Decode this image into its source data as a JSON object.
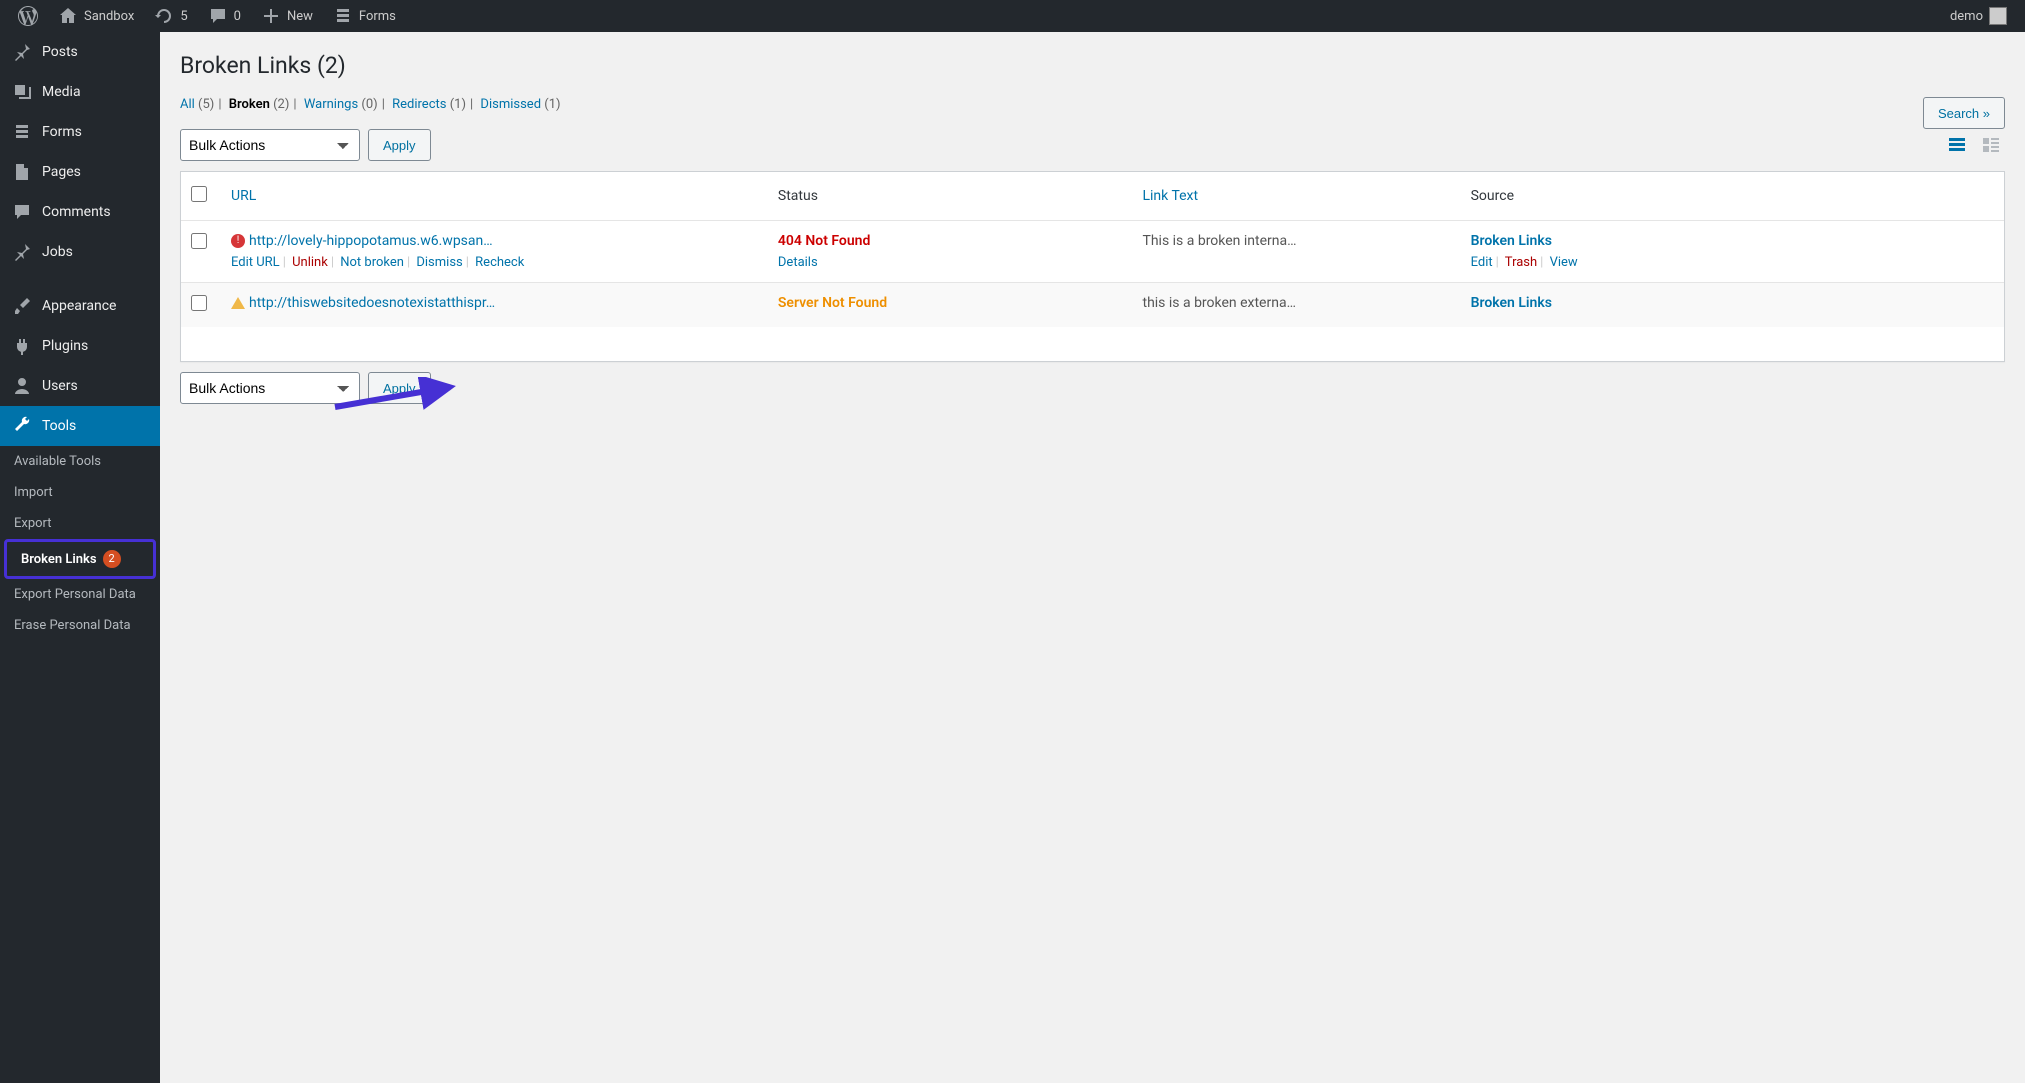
{
  "adminbar": {
    "site_name": "Sandbox",
    "updates": "5",
    "comments": "0",
    "new_label": "New",
    "forms_label": "Forms",
    "user_label": "demo"
  },
  "sidebar": {
    "items": [
      {
        "label": "Posts"
      },
      {
        "label": "Media"
      },
      {
        "label": "Forms"
      },
      {
        "label": "Pages"
      },
      {
        "label": "Comments"
      },
      {
        "label": "Jobs"
      },
      {
        "label": "Appearance"
      },
      {
        "label": "Plugins"
      },
      {
        "label": "Users"
      },
      {
        "label": "Tools"
      }
    ],
    "submenu": [
      {
        "label": "Available Tools"
      },
      {
        "label": "Import"
      },
      {
        "label": "Export"
      },
      {
        "label": "Broken Links",
        "badge": "2"
      },
      {
        "label": "Export Personal Data"
      },
      {
        "label": "Erase Personal Data"
      }
    ]
  },
  "page": {
    "title": "Broken Links (2)",
    "search_button": "Search »",
    "bulk_actions_label": "Bulk Actions",
    "apply_label": "Apply"
  },
  "filters": [
    {
      "label": "All",
      "count": "(5)",
      "current": false
    },
    {
      "label": "Broken",
      "count": "(2)",
      "current": true
    },
    {
      "label": "Warnings",
      "count": "(0)",
      "current": false
    },
    {
      "label": "Redirects",
      "count": "(1)",
      "current": false
    },
    {
      "label": "Dismissed",
      "count": "(1)",
      "current": false
    }
  ],
  "table": {
    "headers": {
      "url": "URL",
      "status": "Status",
      "linktext": "Link Text",
      "source": "Source"
    },
    "rows": [
      {
        "icon": "error",
        "url": "http://lovely-hippopotamus.w6.wpsan…",
        "status": "404 Not Found",
        "status_class": "error",
        "details_label": "Details",
        "linktext": "This is a broken interna…",
        "source": "Broken Links",
        "url_actions": {
          "edit_url": "Edit URL",
          "unlink": "Unlink",
          "not_broken": "Not broken",
          "dismiss": "Dismiss",
          "recheck": "Recheck"
        },
        "source_actions": {
          "edit": "Edit",
          "trash": "Trash",
          "view": "View"
        }
      },
      {
        "icon": "warn",
        "url": "http://thiswebsitedoesnotexistatthispr…",
        "status": "Server Not Found",
        "status_class": "warn",
        "linktext": "this is a broken externa…",
        "source": "Broken Links"
      }
    ]
  }
}
